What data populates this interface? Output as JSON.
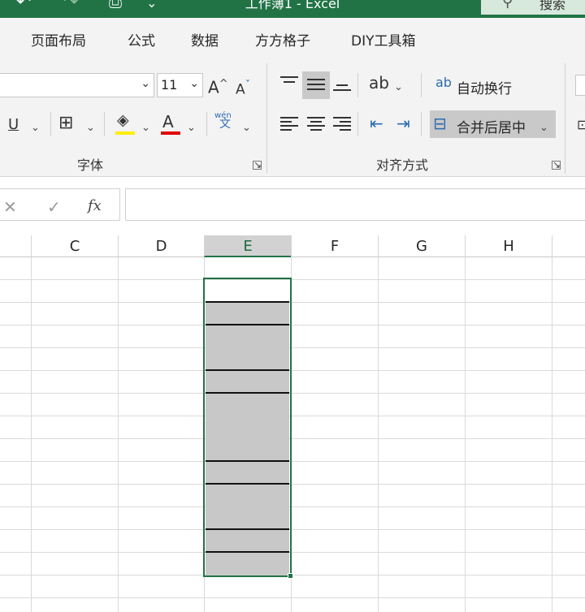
{
  "window": {
    "title": "工作簿1 - Excel",
    "search_label": "搜索",
    "accent_color": "#217346"
  },
  "tabs": [
    {
      "label": "页面布局"
    },
    {
      "label": "公式"
    },
    {
      "label": "数据"
    },
    {
      "label": "方方格子"
    },
    {
      "label": "DIY工具箱"
    }
  ],
  "font_group": {
    "font_name_value": "",
    "font_size_value": "11",
    "grow_label": "A",
    "shrink_label": "A",
    "underline_label": "U",
    "font_color_label": "A",
    "phonetic_label": "wén",
    "phonetic_char": "文",
    "group_label": "字体",
    "fill_color": "#ffee00",
    "font_color": "#e00000"
  },
  "align_group": {
    "wrap_text_label": "自动换行",
    "merge_center_label": "合并后居中",
    "group_label": "对齐方式"
  },
  "formula_bar": {
    "cancel_glyph": "✕",
    "enter_glyph": "✓",
    "fx_label": "fx",
    "value": ""
  },
  "columns": [
    {
      "label": ""
    },
    {
      "label": "C"
    },
    {
      "label": "D"
    },
    {
      "label": "E",
      "selected": true
    },
    {
      "label": "F"
    },
    {
      "label": "G"
    },
    {
      "label": "H"
    },
    {
      "label": ""
    }
  ],
  "selection": {
    "column": "E",
    "fill_color": "#c8c8c8",
    "border_color": "#217346"
  }
}
